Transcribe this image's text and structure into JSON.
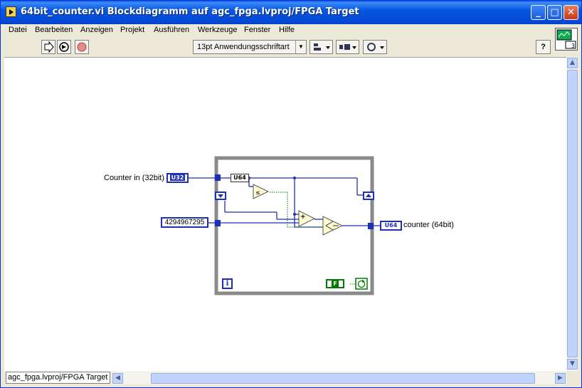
{
  "window": {
    "title": "64bit_counter.vi Blockdiagramm auf agc_fpga.lvproj/FPGA Target",
    "min_glyph": "_",
    "max_glyph": "□",
    "close_glyph": "✕"
  },
  "menu": {
    "items": [
      "Datei",
      "Bearbeiten",
      "Anzeigen",
      "Projekt",
      "Ausführen",
      "Werkzeuge",
      "Fenster",
      "Hilfe"
    ]
  },
  "toolbar": {
    "font_select": "13pt Anwendungsschriftart",
    "help_glyph": "?",
    "context_number": "3"
  },
  "diagram": {
    "input_label": "Counter in (32bit)",
    "input_terminal": "U32",
    "cast_node": "U64",
    "constant_value": "4294967295",
    "output_terminal": "U64",
    "output_label": "counter (64bit)",
    "iteration_glyph": "i",
    "bool_constant": "F",
    "add_glyph": "+"
  },
  "status": {
    "target_label": "agc_fpga.lvproj/FPGA Target"
  },
  "colors": {
    "wire_blue": "#1f2fb8",
    "loop_gray": "#8a8a8a",
    "bool_green": "#007a00",
    "titlebar_blue": "#0448D4"
  }
}
